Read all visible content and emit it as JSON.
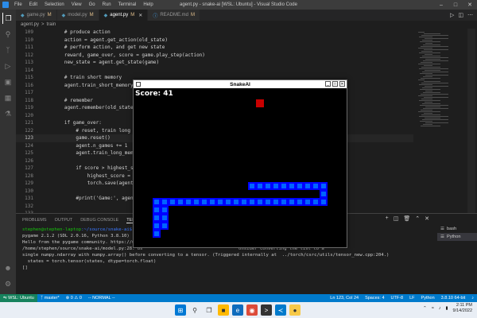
{
  "titlebar": {
    "menu": [
      "File",
      "Edit",
      "Selection",
      "View",
      "Go",
      "Run",
      "Terminal",
      "Help"
    ],
    "title": "agent.py - snake-ai [WSL: Ubuntu] - Visual Studio Code"
  },
  "tabs": [
    {
      "label": "game.py",
      "badge": "M",
      "kind": "py",
      "active": false
    },
    {
      "label": "model.py",
      "badge": "M",
      "kind": "py",
      "active": false
    },
    {
      "label": "agent.py",
      "badge": "M",
      "kind": "py",
      "active": true
    },
    {
      "label": "README.md",
      "badge": "M",
      "kind": "md",
      "active": false
    }
  ],
  "breadcrumb": {
    "file": "agent.py",
    "sep": ">",
    "symbol": "train"
  },
  "editor": {
    "lines": [
      {
        "n": "109",
        "code": "        # produce action",
        "cls": "c-com"
      },
      {
        "n": "110",
        "code": "        action = agent.get_action(old_state)",
        "cls": ""
      },
      {
        "n": "111",
        "code": "        # perform action, and get new state",
        "cls": "c-com"
      },
      {
        "n": "112",
        "code": "        reward, game_over, score = game.play_step(action)",
        "cls": ""
      },
      {
        "n": "113",
        "code": "        new_state = agent.get_state(game)",
        "cls": ""
      },
      {
        "n": "114",
        "code": "",
        "cls": ""
      },
      {
        "n": "115",
        "code": "        # train short memory",
        "cls": "c-com"
      },
      {
        "n": "116",
        "code": "        agent.train_short_memory(old_state, action, reward, new_state, game_over)",
        "cls": ""
      },
      {
        "n": "117",
        "code": "",
        "cls": ""
      },
      {
        "n": "118",
        "code": "        # remember",
        "cls": "c-com"
      },
      {
        "n": "119",
        "code": "        agent.remember(old_state, action, reward, new_state, game_over)",
        "cls": ""
      },
      {
        "n": "120",
        "code": "",
        "cls": ""
      },
      {
        "n": "121",
        "code": "        if game_over:",
        "cls": "c-kw"
      },
      {
        "n": "122",
        "code": "            # reset, train long memory",
        "cls": "c-com"
      },
      {
        "n": "123",
        "code": "            game.reset()",
        "cls": ""
      },
      {
        "n": "124",
        "code": "            agent.n_games += 1",
        "cls": ""
      },
      {
        "n": "125",
        "code": "            agent.train_long_memory()",
        "cls": ""
      },
      {
        "n": "126",
        "code": "",
        "cls": ""
      },
      {
        "n": "127",
        "code": "            if score > highest_score:",
        "cls": "c-kw"
      },
      {
        "n": "128",
        "code": "                highest_score = score",
        "cls": ""
      },
      {
        "n": "129",
        "code": "                torch.save(agent.model",
        "cls": ""
      },
      {
        "n": "130",
        "code": "",
        "cls": ""
      },
      {
        "n": "131",
        "code": "            #print('Game:', agent.n_g",
        "cls": "c-com"
      },
      {
        "n": "132",
        "code": "",
        "cls": ""
      },
      {
        "n": "133",
        "code": "",
        "cls": ""
      },
      {
        "n": "134",
        "code": "if __name__ == '__main__':",
        "cls": "c-kw"
      },
      {
        "n": "135",
        "code": "    train()",
        "cls": "c-fn"
      }
    ],
    "current_line": "123"
  },
  "panel": {
    "tabs": [
      "PROBLEMS",
      "OUTPUT",
      "DEBUG CONSOLE",
      "TERMINAL"
    ],
    "active_tab": "TERMINAL",
    "terminal_lines": [
      {
        "user": "stephen@stephen-laptop",
        "path": ":~/source/snake-ai$",
        "cmd": " /b"
      },
      {
        "text": "pygame 2.1.2 (SDL 2.0.16, Python 3.8.10)"
      },
      {
        "text": "Hello from the pygame community. https://www."
      },
      {
        "text": "/home/stephen/source/snake-ai/model.py:28: Us",
        "tail": "onsider converting the list to a"
      },
      {
        "text": "single numpy.ndarray with numpy.array() before converting to a tensor. (Triggered internally at  ../torch/csrc/utils/tensor_new.cpp:204.)"
      },
      {
        "text": "  states = torch.tensor(states, dtype=torch.float)"
      },
      {
        "text": "[]"
      }
    ],
    "terminals": [
      {
        "label": "bash",
        "active": false
      },
      {
        "label": "Python",
        "active": true
      }
    ]
  },
  "status": {
    "remote": "WSL: Ubuntu",
    "branch": "master*",
    "errors": "0",
    "warnings": "0",
    "mode": "-- NORMAL --",
    "right": [
      "Ln 123, Col 24",
      "Spaces: 4",
      "UTF-8",
      "LF",
      "Python",
      "3.8.10 64-bit"
    ]
  },
  "taskbar": {
    "time": "2:11 PM",
    "date": "9/14/2022"
  },
  "snake": {
    "title": "SnakeAI",
    "score_text": "Score: 41",
    "cell": 10,
    "cols": 26,
    "rows": 20,
    "food": [
      15,
      1
    ],
    "food_color": "#c80000",
    "snake_color": "#0000ff",
    "snake_inner_color": "#0064ff",
    "body": [
      [
        3,
        15
      ],
      [
        3,
        14
      ],
      [
        3,
        13
      ],
      [
        3,
        12
      ],
      [
        4,
        12
      ],
      [
        5,
        12
      ],
      [
        6,
        12
      ],
      [
        7,
        12
      ],
      [
        8,
        12
      ],
      [
        9,
        12
      ],
      [
        10,
        12
      ],
      [
        11,
        12
      ],
      [
        12,
        12
      ],
      [
        13,
        12
      ],
      [
        14,
        12
      ],
      [
        15,
        12
      ],
      [
        16,
        12
      ],
      [
        17,
        12
      ],
      [
        18,
        12
      ],
      [
        19,
        12
      ],
      [
        20,
        12
      ],
      [
        21,
        12
      ],
      [
        22,
        12
      ],
      [
        23,
        12
      ],
      [
        23,
        11
      ],
      [
        23,
        10
      ],
      [
        22,
        10
      ],
      [
        21,
        10
      ],
      [
        20,
        10
      ],
      [
        19,
        10
      ],
      [
        18,
        10
      ],
      [
        17,
        10
      ],
      [
        16,
        10
      ],
      [
        15,
        10
      ],
      [
        14,
        10
      ],
      [
        3,
        14
      ],
      [
        2,
        14
      ],
      [
        2,
        13
      ],
      [
        2,
        12
      ],
      [
        2,
        15
      ],
      [
        2,
        16
      ]
    ]
  },
  "colors": {
    "accent": "#007acc",
    "remote": "#16825d",
    "editor_bg": "#1e1e1e"
  }
}
